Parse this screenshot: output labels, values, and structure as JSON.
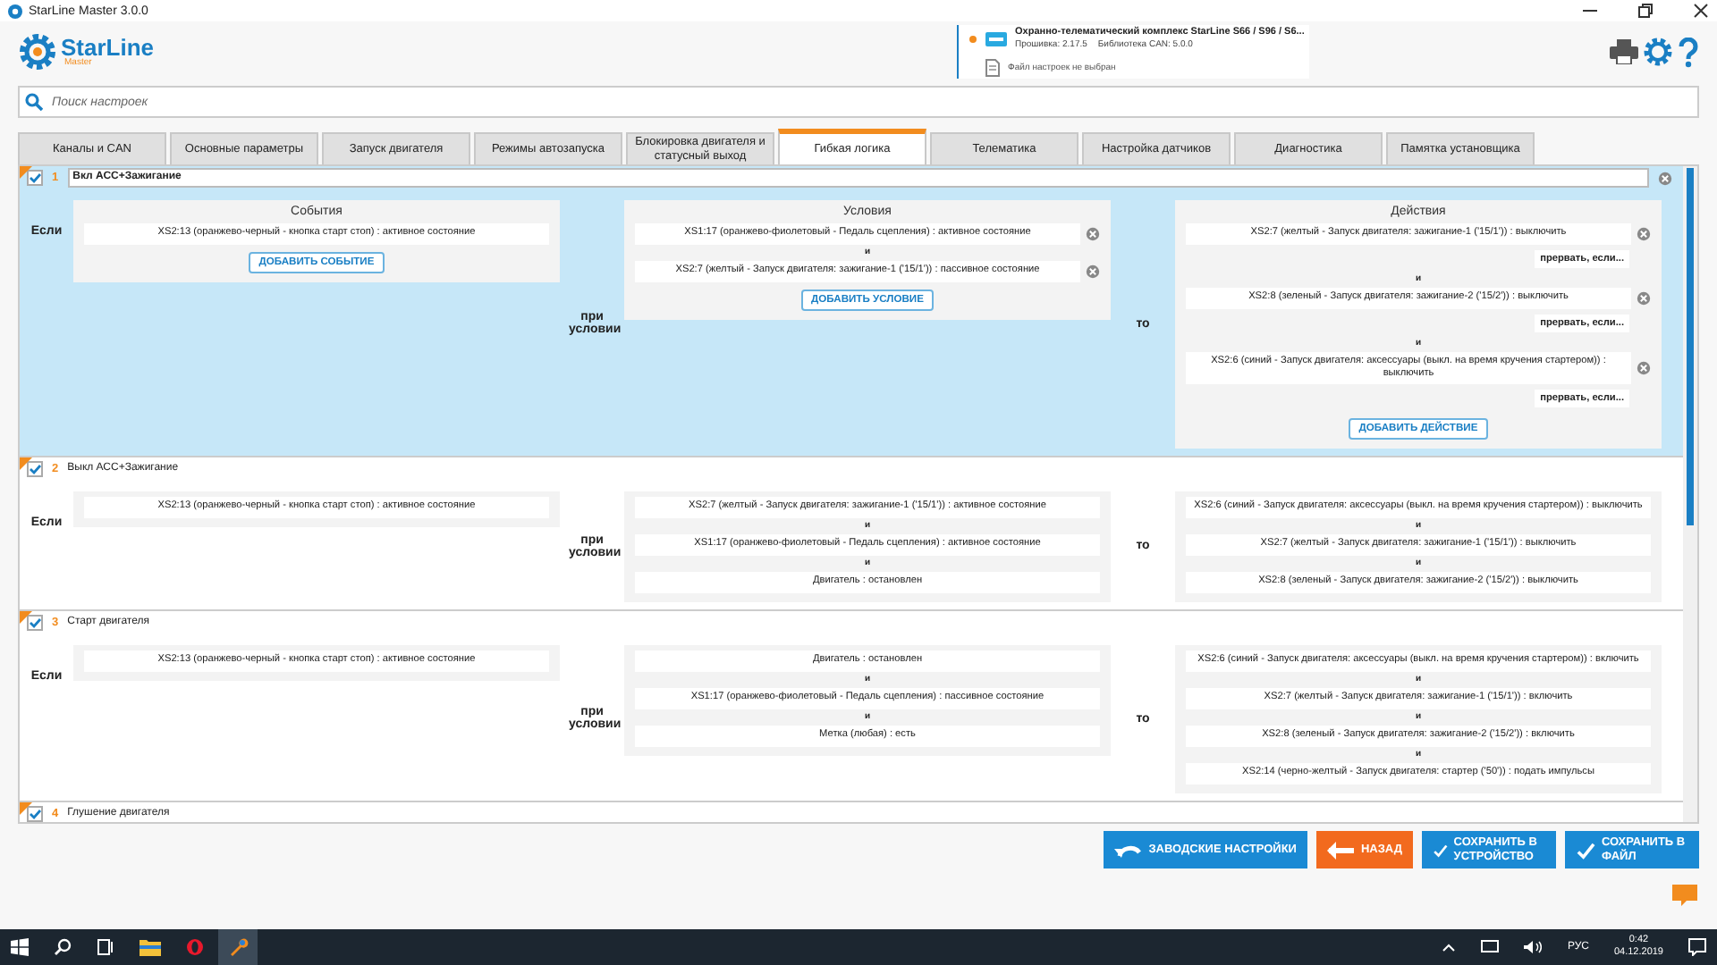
{
  "window": {
    "title": "StarLine Master 3.0.0"
  },
  "logo": {
    "name": "StarLine",
    "sub": "Master"
  },
  "device": {
    "title": "Охранно-телематический комплекс StarLine S66 / S96 / S6...",
    "firmware": "Прошивка: 2.17.5",
    "library": "Библиотека CAN: 5.0.0",
    "file": "Файл настроек не выбран"
  },
  "search": {
    "placeholder": "Поиск настроек"
  },
  "tabs": [
    {
      "label": "Каналы и CAN",
      "selected": false
    },
    {
      "label": "Основные параметры",
      "selected": false
    },
    {
      "label": "Запуск двигателя",
      "selected": false
    },
    {
      "label": "Режимы автозапуска",
      "selected": false
    },
    {
      "label": "Блокировка двигателя и статусный выход",
      "selected": false
    },
    {
      "label": "Гибкая логика",
      "selected": true
    },
    {
      "label": "Телематика",
      "selected": false
    },
    {
      "label": "Настройка датчиков",
      "selected": false
    },
    {
      "label": "Диагностика",
      "selected": false
    },
    {
      "label": "Памятка установщика",
      "selected": false
    }
  ],
  "rules": [
    {
      "number": "1",
      "name": "Вкл АСС+Зажигание",
      "checked": true,
      "selected": true,
      "if_label": "Если",
      "when_label": "при условии",
      "then_label": "то",
      "events": {
        "heading": "События",
        "items": [
          {
            "text": "XS2:13 (оранжево-черный - кнопка старт стоп) : активное состояние"
          }
        ],
        "add_button": "ДОБАВИТЬ СОБЫТИЕ"
      },
      "conditions": {
        "heading": "Условия",
        "items": [
          {
            "text": "XS1:17 (оранжево-фиолетовый - Педаль сцепления) : активное состояние"
          },
          {
            "joiner": "и",
            "text": "XS2:7 (желтый - Запуск двигателя: зажигание-1 ('15/1')) : пассивное состояние"
          }
        ],
        "add_button": "ДОБАВИТЬ УСЛОВИЕ"
      },
      "actions": {
        "heading": "Действия",
        "items": [
          {
            "text": "XS2:7 (желтый - Запуск двигателя: зажигание-1 ('15/1')) : выключить",
            "interrupt": "прервать, если..."
          },
          {
            "joiner": "и",
            "text": "XS2:8 (зеленый - Запуск двигателя: зажигание-2 ('15/2')) : выключить",
            "interrupt": "прервать, если..."
          },
          {
            "joiner": "и",
            "text": "XS2:6 (синий - Запуск двигателя: аксессуары (выкл. на время кручения стартером)) : выключить",
            "interrupt": "прервать, если..."
          }
        ],
        "add_button": "ДОБАВИТЬ ДЕЙСТВИЕ"
      }
    },
    {
      "number": "2",
      "name": "Выкл АСС+Зажигание",
      "checked": true,
      "selected": false,
      "if_label": "Если",
      "when_label": "при условии",
      "then_label": "то",
      "events": {
        "items": [
          {
            "text": "XS2:13 (оранжево-черный - кнопка старт стоп) : активное состояние"
          }
        ]
      },
      "conditions": {
        "items": [
          {
            "text": "XS2:7 (желтый - Запуск двигателя: зажигание-1 ('15/1')) : активное состояние"
          },
          {
            "joiner": "и",
            "text": "XS1:17 (оранжево-фиолетовый - Педаль сцепления) : активное состояние"
          },
          {
            "joiner": "и",
            "text": "Двигатель : остановлен"
          }
        ]
      },
      "actions": {
        "items": [
          {
            "text": "XS2:6 (синий - Запуск двигателя: аксессуары (выкл. на время кручения стартером)) : выключить"
          },
          {
            "joiner": "и",
            "text": "XS2:7 (желтый - Запуск двигателя: зажигание-1 ('15/1')) : выключить"
          },
          {
            "joiner": "и",
            "text": "XS2:8 (зеленый - Запуск двигателя: зажигание-2 ('15/2')) : выключить"
          }
        ]
      }
    },
    {
      "number": "3",
      "name": "Старт двигателя",
      "checked": true,
      "selected": false,
      "if_label": "Если",
      "when_label": "при условии",
      "then_label": "то",
      "events": {
        "items": [
          {
            "text": "XS2:13 (оранжево-черный - кнопка старт стоп) : активное состояние"
          }
        ]
      },
      "conditions": {
        "items": [
          {
            "text": "Двигатель : остановлен"
          },
          {
            "joiner": "и",
            "text": "XS1:17 (оранжево-фиолетовый - Педаль сцепления) : пассивное состояние"
          },
          {
            "joiner": "и",
            "text": "Метка (любая) : есть"
          }
        ]
      },
      "actions": {
        "items": [
          {
            "text": "XS2:6 (синий - Запуск двигателя: аксессуары (выкл. на время кручения стартером)) : включить"
          },
          {
            "joiner": "и",
            "text": "XS2:7 (желтый - Запуск двигателя: зажигание-1 ('15/1')) : включить"
          },
          {
            "joiner": "и",
            "text": "XS2:8 (зеленый - Запуск двигателя: зажигание-2 ('15/2')) : включить"
          },
          {
            "joiner": "и",
            "text": "XS2:14 (черно-желтый - Запуск двигателя: стартер ('50')) : подать импульсы"
          }
        ]
      }
    },
    {
      "number": "4",
      "name": "Глушение двигателя",
      "checked": true,
      "selected": false
    }
  ],
  "buttons": [
    {
      "kind": "reset",
      "label": "ЗАВОДСКИЕ НАСТРОЙКИ"
    },
    {
      "kind": "back",
      "label": "НАЗАД"
    },
    {
      "kind": "save",
      "label": "СОХРАНИТЬ В УСТРОЙСТВО"
    },
    {
      "kind": "save",
      "label": "СОХРАНИТЬ В ФАЙЛ"
    }
  ],
  "taskbar": {
    "language": "РУС",
    "time": "0:42",
    "date": "04.12.2019"
  }
}
